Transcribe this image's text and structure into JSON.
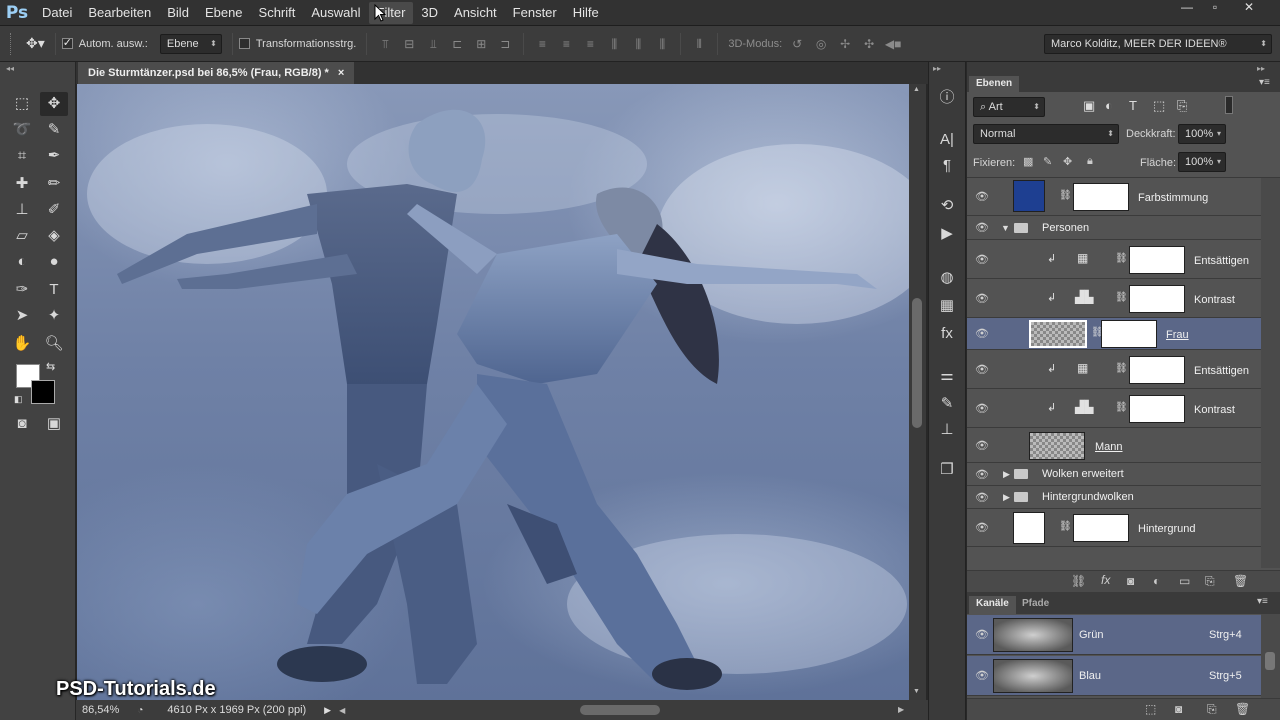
{
  "menubar": {
    "logo": "Ps",
    "items": [
      "Datei",
      "Bearbeiten",
      "Bild",
      "Ebene",
      "Schrift",
      "Auswahl",
      "Filter",
      "3D",
      "Ansicht",
      "Fenster",
      "Hilfe"
    ],
    "active_item": "Filter",
    "window_controls": [
      "minimize",
      "restore",
      "close"
    ]
  },
  "options": {
    "auto_select_label": "Autom. ausw.:",
    "auto_select_checked": true,
    "auto_select_target": "Ebene",
    "transform_label": "Transformationsstrg.",
    "transform_checked": false,
    "mode3d_label": "3D-Modus:",
    "workspace": "Marco Kolditz, MEER DER IDEEN®"
  },
  "document": {
    "tab_title": "Die Sturmtänzer.psd bei 86,5% (Frau, RGB/8) *",
    "zoom": "86,54%",
    "doc_info": "4610 Px x 1969 Px (200 ppi)",
    "watermark": "PSD-Tutorials.de"
  },
  "layers_panel": {
    "tab": "Ebenen",
    "filter_kind": "Art",
    "blend_mode": "Normal",
    "opacity_label": "Deckkraft:",
    "opacity_value": "100%",
    "lock_label": "Fixieren:",
    "fill_label": "Fläche:",
    "fill_value": "100%",
    "layers": [
      {
        "name": "Farbstimmung",
        "type": "adjustment",
        "selected": false
      },
      {
        "name": "Personen",
        "type": "group",
        "expanded": true
      },
      {
        "name": "Entsättigen",
        "type": "adjustment",
        "clipped": true
      },
      {
        "name": "Kontrast",
        "type": "adjustment",
        "clipped": true
      },
      {
        "name": "Frau",
        "type": "smart-object",
        "selected": true
      },
      {
        "name": "Entsättigen",
        "type": "adjustment",
        "clipped": true
      },
      {
        "name": "Kontrast",
        "type": "adjustment",
        "clipped": true
      },
      {
        "name": "Mann",
        "type": "smart-object"
      },
      {
        "name": "Wolken erweitert",
        "type": "group",
        "expanded": false
      },
      {
        "name": "Hintergrundwolken",
        "type": "group",
        "expanded": false
      },
      {
        "name": "Hintergrund",
        "type": "adjustment"
      }
    ]
  },
  "channels_panel": {
    "tabs": [
      "Kanäle",
      "Pfade"
    ],
    "channels": [
      {
        "name": "Grün",
        "shortcut": "Strg+4"
      },
      {
        "name": "Blau",
        "shortcut": "Strg+5"
      }
    ]
  },
  "colors": {
    "accent_selection": "#5b6788",
    "farbstimmung_swatch": "#1e3f91",
    "foreground": "#ffffff",
    "background": "#000000"
  }
}
